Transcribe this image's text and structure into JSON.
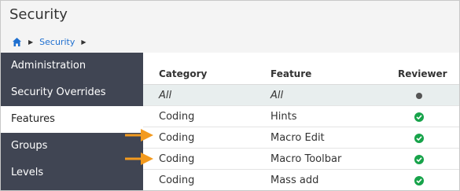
{
  "title": "Security",
  "breadcrumb": {
    "home_icon": "home-icon",
    "items": [
      "Security"
    ]
  },
  "sidebar": {
    "items": [
      {
        "label": "Administration",
        "active": false
      },
      {
        "label": "Security Overrides",
        "active": false
      },
      {
        "label": "Features",
        "active": true
      },
      {
        "label": "Groups",
        "active": false
      },
      {
        "label": "Levels",
        "active": false
      }
    ]
  },
  "table": {
    "headers": [
      "Category",
      "Feature",
      "Reviewer"
    ],
    "rows": [
      {
        "category": "All",
        "feature": "All",
        "reviewer_icon": "dot-icon"
      },
      {
        "category": "Coding",
        "feature": "Hints",
        "reviewer_icon": "check-icon"
      },
      {
        "category": "Coding",
        "feature": "Macro Edit",
        "reviewer_icon": "check-icon",
        "arrow": true
      },
      {
        "category": "Coding",
        "feature": "Macro Toolbar",
        "reviewer_icon": "check-icon",
        "arrow": true
      },
      {
        "category": "Coding",
        "feature": "Mass add",
        "reviewer_icon": "check-icon"
      }
    ]
  },
  "colors": {
    "sidebar_bg": "#404553",
    "link": "#1e6fd0",
    "check": "#17a34a",
    "arrow": "#f39a1e"
  }
}
